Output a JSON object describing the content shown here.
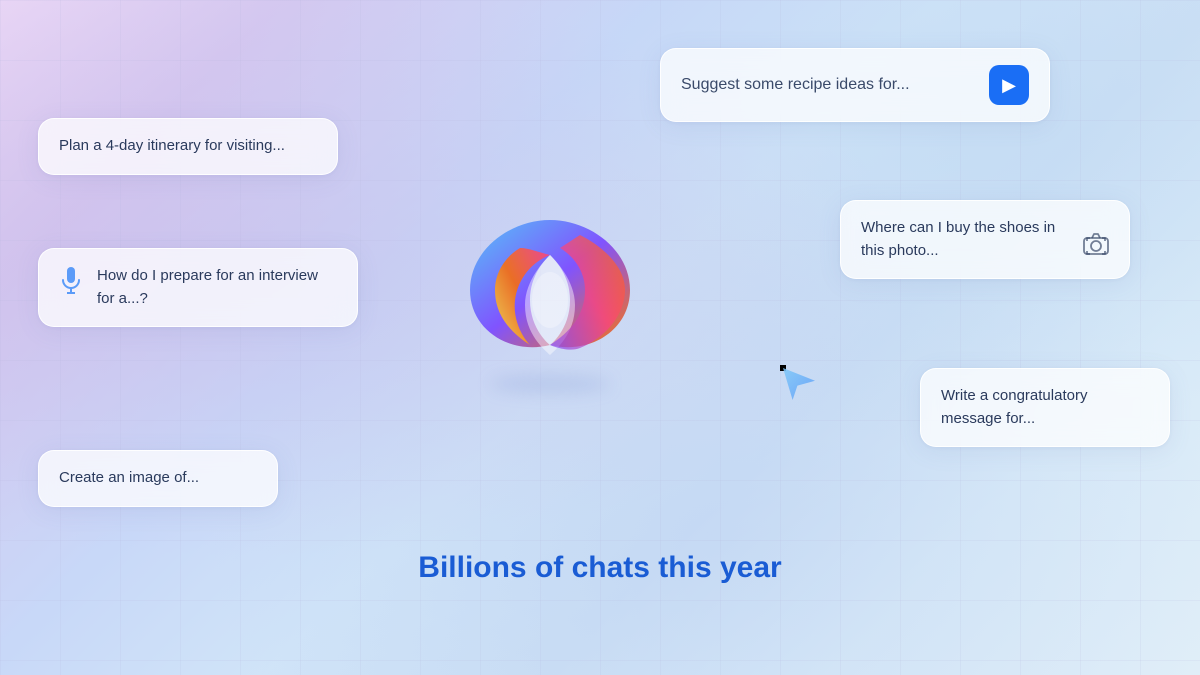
{
  "background": {
    "tagline": "Billions of chats this year"
  },
  "cards": {
    "itinerary": {
      "text": "Plan a 4-day itinerary for visiting..."
    },
    "interview": {
      "text": "How do I prepare for an interview for a...?"
    },
    "image": {
      "text": "Create an image of..."
    },
    "recipe": {
      "text": "Suggest some recipe ideas for...",
      "button_label": "Send"
    },
    "shoes": {
      "text": "Where can I buy the shoes in this photo..."
    },
    "congrats": {
      "text": "Write a congratulatory message for..."
    }
  },
  "icons": {
    "mic": "🎤",
    "send": "▶",
    "camera": "⊙"
  }
}
